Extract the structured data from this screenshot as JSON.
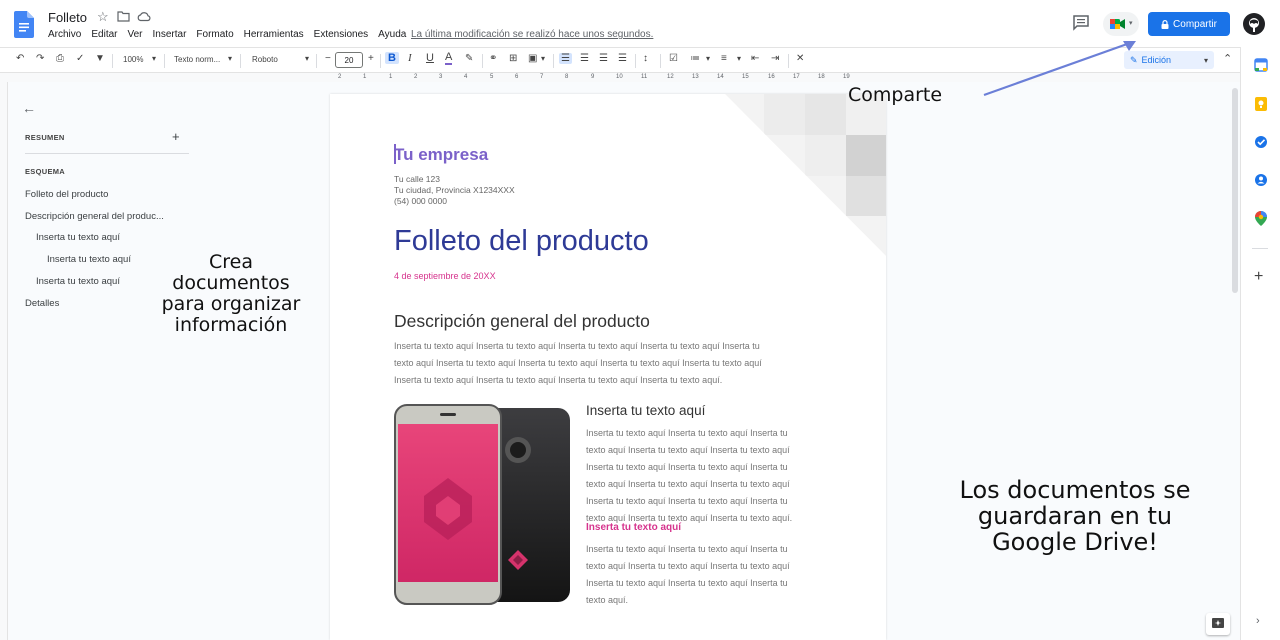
{
  "app": {
    "doc_title": "Folleto",
    "menu": [
      "Archivo",
      "Editar",
      "Ver",
      "Insertar",
      "Formato",
      "Herramientas",
      "Extensiones",
      "Ayuda"
    ],
    "last_edit": "La última modificación se realizó hace unos segundos.",
    "share_label": "Compartir",
    "accent": "#1a73e8"
  },
  "toolbar": {
    "zoom": "100%",
    "style": "Texto norm...",
    "font": "Roboto",
    "font_size": "20",
    "bold": "B",
    "italic": "I",
    "underline": "U",
    "text_color": "A",
    "minus": "−",
    "plus": "+",
    "mode": "Edición"
  },
  "ruler": [
    "2",
    "1",
    "1",
    "2",
    "3",
    "4",
    "5",
    "6",
    "7",
    "8",
    "9",
    "10",
    "11",
    "12",
    "13",
    "14",
    "15",
    "16",
    "17",
    "18",
    "19"
  ],
  "outline": {
    "summary_label": "RESUMEN",
    "outline_label": "ESQUEMA",
    "items": [
      {
        "label": "Folleto del producto"
      },
      {
        "label": "Descripción general del produc..."
      },
      {
        "label": "Inserta tu texto aquí"
      },
      {
        "label": "Inserta tu texto aquí"
      },
      {
        "label": "Inserta tu texto aquí"
      },
      {
        "label": "Detalles"
      }
    ]
  },
  "annotations": {
    "left": [
      "Crea",
      "documentos",
      "para organizar",
      "información"
    ],
    "top": "Comparte",
    "right": [
      "Los documentos se",
      "guardaran en tu",
      "Google Drive!"
    ]
  },
  "page": {
    "company": "Tu empresa",
    "address": [
      "Tu calle 123",
      "Tu ciudad, Provincia X1234XXX",
      "(54) 000 0000"
    ],
    "heading": "Folleto del producto",
    "date": "4 de septiembre de 20XX",
    "section_title": "Descripción general del producto",
    "section_body": [
      "Inserta tu texto aquí Inserta tu texto aquí Inserta tu texto aquí Inserta tu texto aquí Inserta tu",
      "texto aquí Inserta tu texto aquí Inserta tu texto aquí Inserta tu texto aquí Inserta tu texto aquí",
      "Inserta tu texto aquí Inserta tu texto aquí Inserta tu texto aquí Inserta tu texto aquí."
    ],
    "sub1_title": "Inserta tu texto aquí",
    "sub1_body": [
      "Inserta tu texto aquí Inserta tu texto aquí Inserta tu",
      "texto aquí Inserta tu texto aquí Inserta tu texto aquí",
      "Inserta tu texto aquí Inserta tu texto aquí Inserta tu",
      "texto aquí Inserta tu texto aquí Inserta tu texto aquí",
      "Inserta tu texto aquí Inserta tu texto aquí Inserta tu",
      "texto aquí Inserta tu texto aquí Inserta tu texto aquí."
    ],
    "sub2_title": "Inserta tu texto aquí",
    "sub2_body": [
      "Inserta tu texto aquí Inserta tu texto aquí Inserta tu",
      "texto aquí Inserta tu texto aquí Inserta tu texto aquí",
      "Inserta tu texto aquí Inserta tu texto aquí Inserta tu",
      "texto aquí."
    ]
  }
}
